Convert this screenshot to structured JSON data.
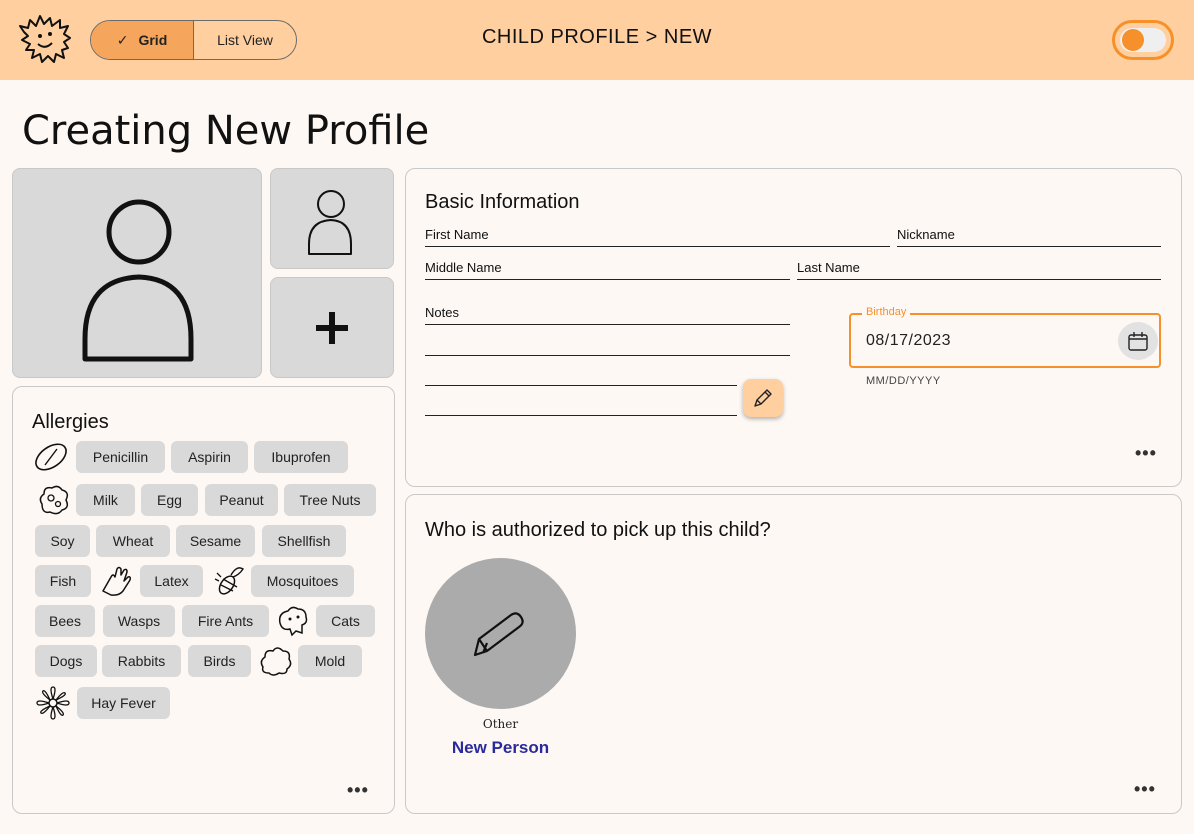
{
  "header": {
    "view_toggle": {
      "grid_label": "Grid",
      "list_label": "List View",
      "selected": "Grid",
      "check_icon": "checkmark-icon"
    },
    "title": "CHILD PROFILE > NEW",
    "theme_switch": {
      "on": false
    }
  },
  "page": {
    "title": "Creating New Profile"
  },
  "photos": {
    "main_icon": "person-icon",
    "thumb_icon": "person-icon",
    "add_icon": "plus-icon"
  },
  "allergies": {
    "title": "Allergies",
    "groups": [
      {
        "icon": "pill-icon",
        "items": [
          "Penicillin",
          "Aspirin",
          "Ibuprofen"
        ]
      },
      {
        "icon": "food-icon",
        "items": [
          "Milk",
          "Egg",
          "Peanut",
          "Tree Nuts",
          "Soy",
          "Wheat",
          "Sesame",
          "Shellfish",
          "Fish"
        ]
      },
      {
        "icon": "glove-icon",
        "items": [
          "Latex"
        ]
      },
      {
        "icon": "insect-icon",
        "items": [
          "Mosquitoes",
          "Bees",
          "Wasps",
          "Fire Ants"
        ]
      },
      {
        "icon": "animal-icon",
        "items": [
          "Cats",
          "Dogs",
          "Rabbits",
          "Birds"
        ]
      },
      {
        "icon": "mold-icon",
        "items": [
          "Mold"
        ]
      },
      {
        "icon": "flower-icon",
        "items": [
          "Hay Fever"
        ]
      }
    ],
    "chips": {
      "penicillin": "Penicillin",
      "aspirin": "Aspirin",
      "ibuprofen": "Ibuprofen",
      "milk": "Milk",
      "egg": "Egg",
      "peanut": "Peanut",
      "tree_nuts": "Tree Nuts",
      "soy": "Soy",
      "wheat": "Wheat",
      "sesame": "Sesame",
      "shellfish": "Shellfish",
      "fish": "Fish",
      "latex": "Latex",
      "mosquitoes": "Mosquitoes",
      "bees": "Bees",
      "wasps": "Wasps",
      "fire_ants": "Fire Ants",
      "cats": "Cats",
      "dogs": "Dogs",
      "rabbits": "Rabbits",
      "birds": "Birds",
      "mold": "Mold",
      "hay_fever": "Hay Fever"
    },
    "more_label": "•••"
  },
  "basic_info": {
    "title": "Basic Information",
    "first_name_label": "First Name",
    "nickname_label": "Nickname",
    "middle_name_label": "Middle Name",
    "last_name_label": "Last Name",
    "notes_label": "Notes",
    "birthday_label": "Birthday",
    "birthday_value": "08/17/2023",
    "birthday_hint": "MM/DD/YYYY",
    "more_label": "•••"
  },
  "pickup": {
    "title": "Who is authorized to pick up this child?",
    "people": [
      {
        "role": "Other",
        "name": "New Person",
        "icon": "pencil-icon"
      }
    ],
    "more_label": "•••"
  },
  "colors": {
    "header_bg": "#ffcf9f",
    "accent": "#f5902a",
    "chip_bg": "#d9d9d9",
    "link": "#2a2a9c"
  }
}
